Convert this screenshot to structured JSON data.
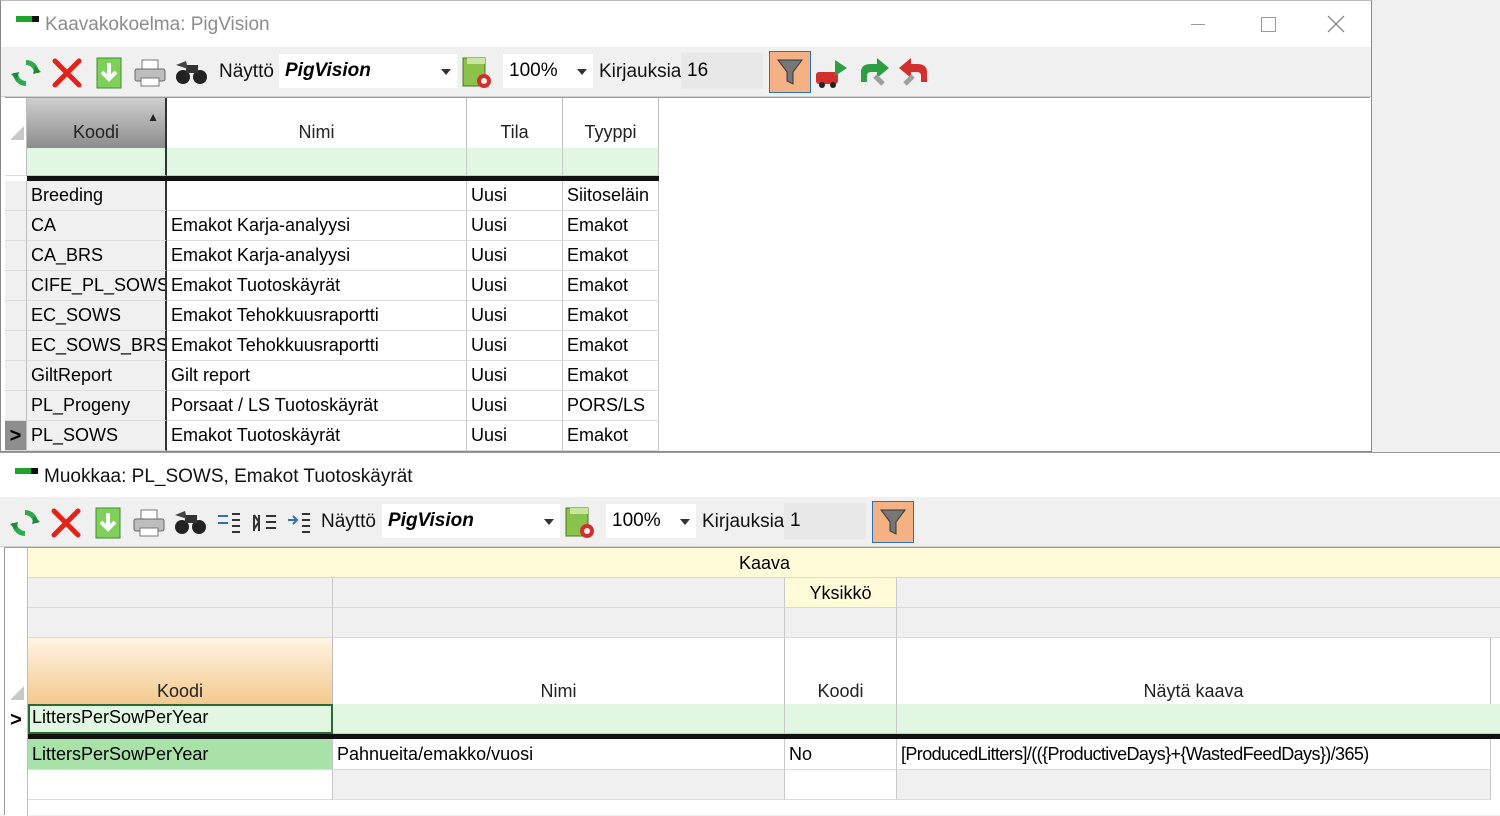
{
  "window1": {
    "title": "Kaavakokoelma: PigVision",
    "toolbar": {
      "display_label": "Näyttö",
      "display_value": "PigVision",
      "zoom_value": "100%",
      "records_label": "Kirjauksia",
      "records_count": "16"
    },
    "grid": {
      "columns": [
        "Koodi",
        "Nimi",
        "Tila",
        "Tyyppi"
      ],
      "sort_indicator": "▲",
      "rows": [
        [
          "Breeding",
          "",
          "Uusi",
          "Siitoseläin"
        ],
        [
          "CA",
          "Emakot Karja-analyysi",
          "Uusi",
          "Emakot"
        ],
        [
          "CA_BRS",
          "Emakot Karja-analyysi",
          "Uusi",
          "Emakot"
        ],
        [
          "CIFE_PL_SOWS",
          "Emakot Tuotoskäyrät",
          "Uusi",
          "Emakot"
        ],
        [
          "EC_SOWS",
          "Emakot Tehokkuusraportti",
          "Uusi",
          "Emakot"
        ],
        [
          "EC_SOWS_BRS",
          "Emakot Tehokkuusraportti",
          "Uusi",
          "Emakot"
        ],
        [
          "GiltReport",
          "Gilt report",
          "Uusi",
          "Emakot"
        ],
        [
          "PL_Progeny",
          "Porsaat / LS Tuotoskäyrät",
          "Uusi",
          "PORS/LS"
        ],
        [
          "PL_SOWS",
          "Emakot Tuotoskäyrät",
          "Uusi",
          "Emakot"
        ]
      ],
      "current_row_marker": ">"
    }
  },
  "window2": {
    "title": "Muokkaa: PL_SOWS, Emakot Tuotoskäyrät",
    "toolbar": {
      "display_label": "Näyttö",
      "display_value": "PigVision",
      "zoom_value": "100%",
      "records_label": "Kirjauksia",
      "records_count": "1"
    },
    "grid": {
      "band_top": "Kaava",
      "band_mid": "Yksikkö",
      "columns": [
        "Koodi",
        "Nimi",
        "Koodi",
        "Näytä kaava"
      ],
      "filter_value": "LittersPerSowPerYear",
      "row_marker": ">",
      "rows": [
        [
          "LittersPerSowPerYear",
          "Pahnueita/emakko/vuosi",
          "No",
          "[ProducedLitters]/(({ProductiveDays}+{WastedFeedDays})/365)"
        ]
      ]
    }
  },
  "colors": {
    "filter_row": "#e2f7e2",
    "sort_header": "#f4c98e",
    "selected_cell": "#a8e2a8",
    "band": "#fffbd9",
    "filter_button": "#f4b183"
  }
}
